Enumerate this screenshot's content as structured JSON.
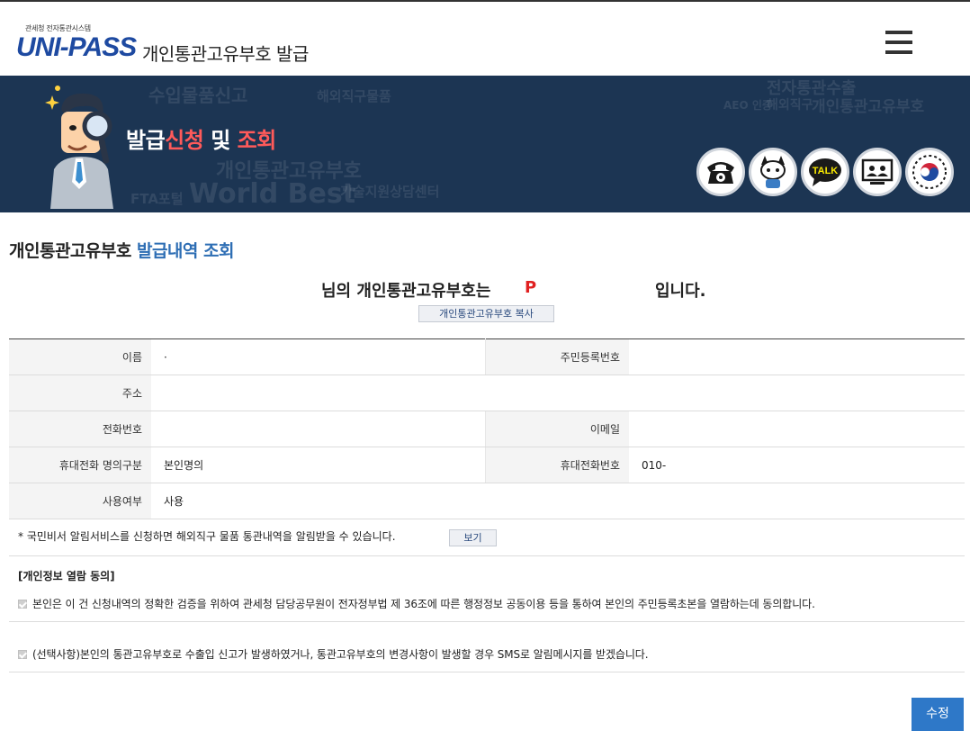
{
  "header": {
    "logo_subtitle": "관세청 전자통관시스템",
    "logo_text": "UNI-PASS",
    "page_title": "개인통관고유부호  발급"
  },
  "banner": {
    "title_part1": "발급",
    "title_part2": "신청",
    "title_part3": " 및 ",
    "title_part4": "조회",
    "watermark_words": [
      "수입물품신고",
      "해외직구물품",
      "개인통관고유부호",
      "World Best",
      "FTA포털",
      "기술지원상담센터",
      "전자통관수출",
      "AEO 인증",
      "해외직구",
      "개인통관고유부호"
    ],
    "quick_icons": [
      "phone-icon",
      "chatbot-icon",
      "kakaotalk-icon",
      "remote-support-icon",
      "government-emblem-icon"
    ],
    "talk_label": "TALK"
  },
  "main": {
    "section_title_plain": "개인통관고유부호 ",
    "section_title_highlight": "발급내역 조회",
    "notice_prefix": "님의 개인통관고유부호는",
    "notice_code": "P",
    "notice_suffix": "입니다.",
    "copy_button": "개인통관고유부호 복사"
  },
  "table": {
    "name_label": "이름",
    "name_value": "·",
    "ssn_label": "주민등록번호",
    "ssn_value": "",
    "address_label": "주소",
    "address_value": "",
    "phone_label": "전화번호",
    "phone_value": "",
    "email_label": "이메일",
    "email_value": "",
    "mobile_owner_label": "휴대전화 명의구분",
    "mobile_owner_value": "본인명의",
    "mobile_label": "휴대전화번호",
    "mobile_value": "010-",
    "usage_label": "사용여부",
    "usage_value": "사용"
  },
  "alert": {
    "text": "* 국민비서 알림서비스를 신청하면 해외직구 물품 통관내역을 알림받을 수 있습니다.",
    "view_button": "보기"
  },
  "consent": {
    "title": "[개인정보 열람 동의]",
    "item1": "본인은 이 건 신청내역의 정확한 검증을 위하여 관세청 담당공무원이 전자정부법 제 36조에 따른 행정정보 공동이용 등을 통하여 본인의 주민등록초본을 열람하는데 동의합니다.",
    "item2": "(선택사항)본인의 통관고유부호로 수출입 신고가 발생하였거나, 통관고유부호의 변경사항이 발생할 경우 SMS로 알림메시지를 받겠습니다."
  },
  "actions": {
    "edit_button": "수정"
  }
}
